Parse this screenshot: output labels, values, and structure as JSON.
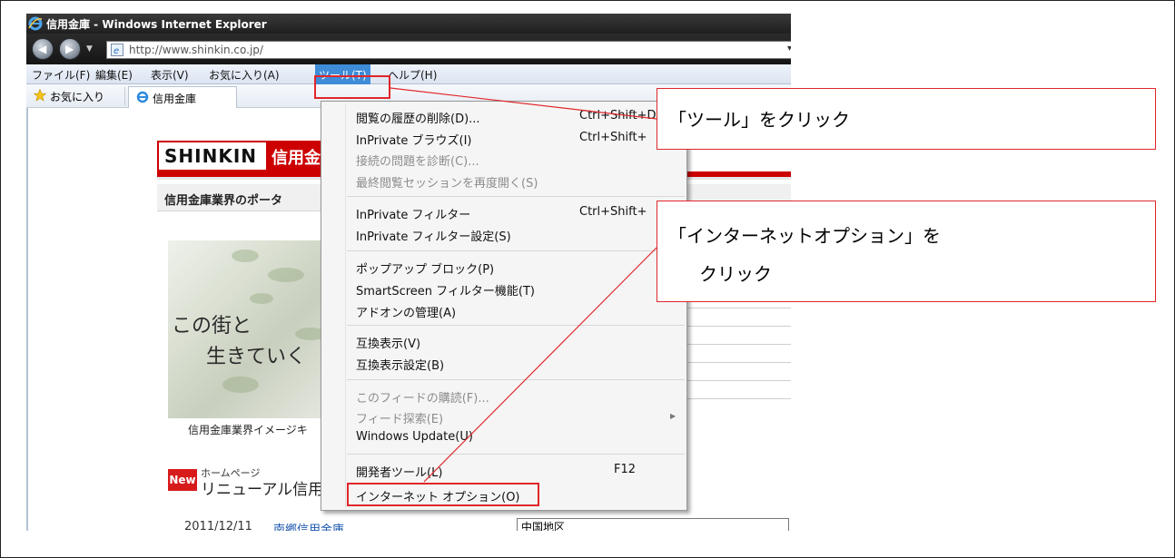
{
  "window": {
    "title": "信用金庫 - Windows Internet Explorer",
    "address": "http://www.shinkin.co.jp/"
  },
  "menubar": {
    "items": [
      "ファイル(F)",
      "編集(E)",
      "表示(V)",
      "お気に入り(A)",
      "ツール(T)",
      "ヘルプ(H)"
    ],
    "active_index": 4
  },
  "favbar": {
    "favorites_label": "お気に入り",
    "tab_label": "信用金庫"
  },
  "page": {
    "logo_text": "SHINKIN",
    "logo_red_text": "信用金",
    "portal_text": "信用金庫業界のポータ",
    "hero_line1": "この街と",
    "hero_line2": "生きていく",
    "hero_caption": "信用金庫業界イメージキ",
    "new_badge": "New",
    "news_sub": "ホームページ",
    "news_title": "リニューアル信用",
    "bottom_date": "2011/12/11",
    "bottom_bank": "南郷信用金庫",
    "bottom_region": "中国地区"
  },
  "tools_menu": {
    "groups": [
      [
        {
          "label": "閲覧の履歴の削除(D)...",
          "shortcut": "Ctrl+Shift+D",
          "disabled": false
        },
        {
          "label": "InPrivate ブラウズ(I)",
          "shortcut": "Ctrl+Shift+",
          "disabled": false
        },
        {
          "label": "接続の問題を診断(C)...",
          "shortcut": "",
          "disabled": true
        },
        {
          "label": "最終閲覧セッションを再度開く(S)",
          "shortcut": "",
          "disabled": true
        }
      ],
      [
        {
          "label": "InPrivate フィルター",
          "shortcut": "Ctrl+Shift+",
          "disabled": false
        },
        {
          "label": "InPrivate フィルター設定(S)",
          "shortcut": "",
          "disabled": false
        }
      ],
      [
        {
          "label": "ポップアップ ブロック(P)",
          "shortcut": "",
          "disabled": false
        },
        {
          "label": "SmartScreen フィルター機能(T)",
          "shortcut": "",
          "disabled": false
        },
        {
          "label": "アドオンの管理(A)",
          "shortcut": "",
          "disabled": false
        }
      ],
      [
        {
          "label": "互換表示(V)",
          "shortcut": "",
          "disabled": false
        },
        {
          "label": "互換表示設定(B)",
          "shortcut": "",
          "disabled": false
        }
      ],
      [
        {
          "label": "このフィードの購読(F)...",
          "shortcut": "",
          "disabled": true
        },
        {
          "label": "フィード探索(E)",
          "shortcut": "",
          "disabled": true,
          "submenu": true
        },
        {
          "label": "Windows Update(U)",
          "shortcut": "",
          "disabled": false
        }
      ],
      [
        {
          "label": "開発者ツール(L)",
          "shortcut": "F12",
          "disabled": false
        },
        {
          "label": "インターネット オプション(O)",
          "shortcut": "",
          "disabled": false
        }
      ]
    ]
  },
  "callouts": {
    "tools": "「ツール」をクリック",
    "options_line1": "「インターネットオプション」を",
    "options_line2": "クリック"
  },
  "colors": {
    "highlight_red": "#e0262a",
    "menu_active": "#3e8cd8",
    "brand_red": "#cc0000"
  }
}
